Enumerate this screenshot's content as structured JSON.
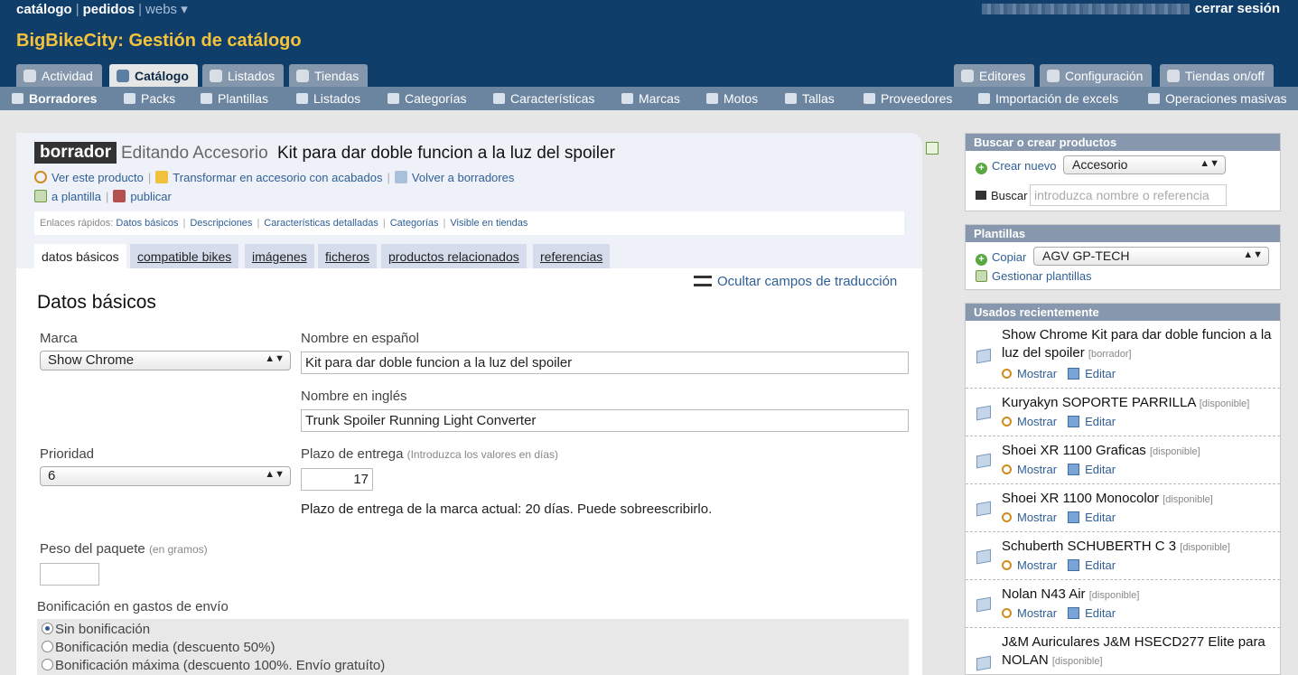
{
  "appnav": {
    "catalogo": "catálogo",
    "pedidos": "pedidos",
    "webs": "webs ▾",
    "logout": "cerrar sesión"
  },
  "app_title": "BigBikeCity: Gestión de catálogo",
  "main_tabs": [
    "Actividad",
    "Catálogo",
    "Listados",
    "Tiendas"
  ],
  "right_tabs": [
    "Editores",
    "Configuración",
    "Tiendas on/off"
  ],
  "subnav": [
    "Borradores",
    "Packs",
    "Plantillas",
    "Listados",
    "Categorías",
    "Características",
    "Marcas",
    "Motos",
    "Tallas",
    "Proveedores",
    "Importación de excels",
    "Operaciones masivas"
  ],
  "product": {
    "badge": "borrador",
    "edit_label": "Editando Accesorio",
    "title": "Kit para dar doble funcion a la luz del spoiler",
    "actions": [
      "Ver este producto",
      "Transformar en accesorio con acabados",
      "Volver a borradores"
    ],
    "actions2": [
      "a plantilla",
      "publicar"
    ],
    "quick_label": "Enlaces rápidos:",
    "quick_links": [
      "Datos básicos",
      "Descripciones",
      "Características detalladas",
      "Categorías",
      "Visible en tiendas"
    ],
    "tabs": [
      "datos básicos",
      "compatible bikes",
      "imágenes",
      "ficheros",
      "productos relacionados",
      "referencias"
    ],
    "hide_translation": "Ocultar campos de traducción"
  },
  "form": {
    "section_title": "Datos básicos",
    "marca_label": "Marca",
    "marca_value": "Show Chrome",
    "nombre_es_label": "Nombre en español",
    "nombre_es_value": "Kit para dar doble funcion a la luz del spoiler",
    "nombre_en_label": "Nombre en inglés",
    "nombre_en_value": "Trunk Spoiler Running Light Converter",
    "prioridad_label": "Prioridad",
    "prioridad_value": "6",
    "plazo_label": "Plazo de entrega",
    "plazo_hint": "(Introduzca los valores en días)",
    "plazo_value": "17",
    "plazo_note": "Plazo de entrega de la marca actual: 20 días. Puede sobreescribirlo.",
    "peso_label": "Peso del paquete",
    "peso_hint": "(en gramos)",
    "peso_value": "",
    "bonif_label": "Bonificación en gastos de envío",
    "bonif_options": [
      "Sin bonificación",
      "Bonificación media (descuento 50%)",
      "Bonificación máxima (descuento 100%. Envío gratuíto)"
    ],
    "bonif_selected": 0
  },
  "search_panel": {
    "title": "Buscar o crear productos",
    "crear": "Crear nuevo",
    "tipo": "Accesorio",
    "buscar": "Buscar",
    "placeholder": "introduzca nombre o referencia"
  },
  "templates_panel": {
    "title": "Plantillas",
    "copiar": "Copiar",
    "plantilla": "AGV GP-TECH",
    "gestionar": "Gestionar plantillas"
  },
  "recent": {
    "title": "Usados recientemente",
    "mostrar": "Mostrar",
    "editar": "Editar",
    "items": [
      {
        "name": "Show Chrome Kit para dar doble funcion a la luz del spoiler",
        "status": "[borrador]"
      },
      {
        "name": "Kuryakyn SOPORTE PARRILLA",
        "status": "[disponible]"
      },
      {
        "name": "Shoei XR 1100 Graficas",
        "status": "[disponible]"
      },
      {
        "name": "Shoei XR 1100 Monocolor",
        "status": "[disponible]"
      },
      {
        "name": "Schuberth SCHUBERTH C 3",
        "status": "[disponible]"
      },
      {
        "name": "Nolan N43 Air",
        "status": "[disponible]"
      },
      {
        "name": "J&M Auriculares J&M HSECD277 Elite para NOLAN",
        "status": "[disponible]"
      }
    ]
  }
}
